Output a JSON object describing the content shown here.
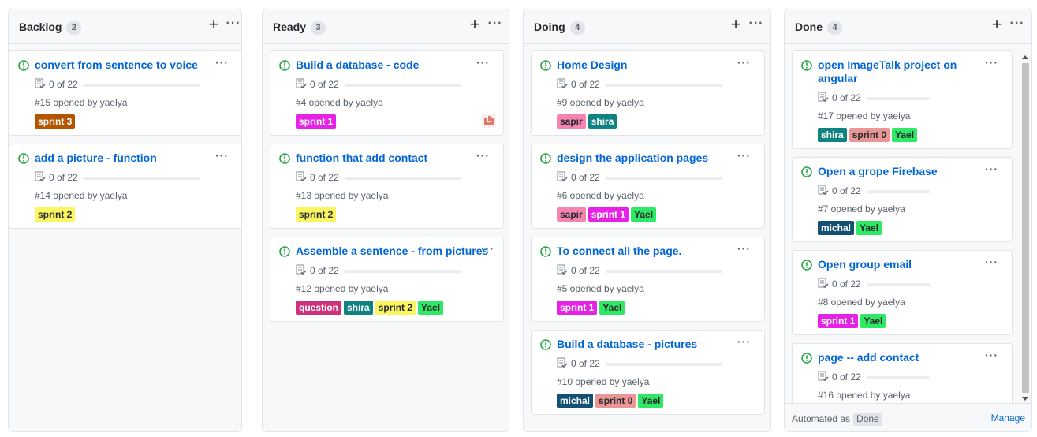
{
  "columns": {
    "backlog": {
      "name": "Backlog",
      "count": "2",
      "cards": [
        {
          "title": "convert from sentence to voice",
          "tasks": "0 of 22",
          "opened": "#15 opened by yaelya",
          "labels": [
            {
              "text": "sprint 3",
              "bg": "#b35400",
              "fg": "#ffffff"
            }
          ]
        },
        {
          "title": "add a picture - function",
          "tasks": "0 of 22",
          "opened": "#14 opened by yaelya",
          "labels": [
            {
              "text": "sprint 2",
              "bg": "#fbf55f",
              "fg": "#24292e"
            }
          ]
        }
      ]
    },
    "ready": {
      "name": "Ready",
      "count": "3",
      "cards": [
        {
          "title": "Build a database - code",
          "tasks": "0 of 22",
          "opened": "#4 opened by yaelya",
          "labels": [
            {
              "text": "sprint 1",
              "bg": "#e622e6",
              "fg": "#ffffff"
            }
          ]
        },
        {
          "title": "function that add contact",
          "tasks": "0 of 22",
          "opened": "#13 opened by yaelya",
          "labels": [
            {
              "text": "sprint 2",
              "bg": "#fbf55f",
              "fg": "#24292e"
            }
          ]
        },
        {
          "title": "Assemble a sentence - from pictures",
          "tasks": "0 of 22",
          "opened": "#12 opened by yaelya",
          "labels": [
            {
              "text": "question",
              "bg": "#cc317c",
              "fg": "#ffffff"
            },
            {
              "text": "shira",
              "bg": "#108282",
              "fg": "#ffffff"
            },
            {
              "text": "sprint 2",
              "bg": "#fbf55f",
              "fg": "#24292e"
            },
            {
              "text": "Yael",
              "bg": "#2fe866",
              "fg": "#24292e"
            }
          ]
        }
      ]
    },
    "doing": {
      "name": "Doing",
      "count": "4",
      "cards": [
        {
          "title": "Home Design",
          "tasks": "0 of 22",
          "opened": "#9 opened by yaelya",
          "labels": [
            {
              "text": "sapir",
              "bg": "#f683b0",
              "fg": "#24292e"
            },
            {
              "text": "shira",
              "bg": "#108282",
              "fg": "#ffffff"
            }
          ]
        },
        {
          "title": "design the application pages",
          "tasks": "0 of 22",
          "opened": "#6 opened by yaelya",
          "labels": [
            {
              "text": "sapir",
              "bg": "#f683b0",
              "fg": "#24292e"
            },
            {
              "text": "sprint 1",
              "bg": "#e622e6",
              "fg": "#ffffff"
            },
            {
              "text": "Yael",
              "bg": "#2fe866",
              "fg": "#24292e"
            }
          ]
        },
        {
          "title": "To connect all the page.",
          "tasks": "0 of 22",
          "opened": "#5 opened by yaelya",
          "labels": [
            {
              "text": "sprint 1",
              "bg": "#e622e6",
              "fg": "#ffffff"
            },
            {
              "text": "Yael",
              "bg": "#2fe866",
              "fg": "#24292e"
            }
          ]
        },
        {
          "title": "Build a database - pictures",
          "tasks": "0 of 22",
          "opened": "#10 opened by yaelya",
          "labels": [
            {
              "text": "michal",
              "bg": "#145074",
              "fg": "#ffffff"
            },
            {
              "text": "sprint 0",
              "bg": "#e99695",
              "fg": "#24292e"
            },
            {
              "text": "Yael",
              "bg": "#2fe866",
              "fg": "#24292e"
            }
          ]
        }
      ]
    },
    "done": {
      "name": "Done",
      "count": "4",
      "cards": [
        {
          "title": "open ImageTalk project on",
          "title2": "angular",
          "tasks": "0 of 22",
          "opened": "#17 opened by yaelya",
          "labels": [
            {
              "text": "shira",
              "bg": "#108282",
              "fg": "#ffffff"
            },
            {
              "text": "sprint 0",
              "bg": "#e99695",
              "fg": "#24292e"
            },
            {
              "text": "Yael",
              "bg": "#2fe866",
              "fg": "#24292e"
            }
          ]
        },
        {
          "title": "Open a grope Firebase",
          "tasks": "0 of 22",
          "opened": "#7 opened by yaelya",
          "labels": [
            {
              "text": "michal",
              "bg": "#145074",
              "fg": "#ffffff"
            },
            {
              "text": "Yael",
              "bg": "#2fe866",
              "fg": "#24292e"
            }
          ]
        },
        {
          "title": "Open group email",
          "tasks": "0 of 22",
          "opened": "#8 opened by yaelya",
          "labels": [
            {
              "text": "sprint 1",
              "bg": "#e622e6",
              "fg": "#ffffff"
            },
            {
              "text": "Yael",
              "bg": "#2fe866",
              "fg": "#24292e"
            }
          ]
        },
        {
          "title": "page -- add contact",
          "tasks": "0 of 22",
          "opened": "#16 opened by yaelya",
          "labels": []
        }
      ],
      "footer": {
        "automated": "Automated as",
        "status": "Done",
        "manage": "Manage"
      }
    }
  },
  "icons": {
    "add": "+",
    "more": "···",
    "issue_icon": "issue-opened-icon",
    "tasks_icon": "tasklist-icon"
  },
  "colors": {
    "link": "#0366d6",
    "issue_open": "#28a745",
    "muted": "#586069"
  }
}
